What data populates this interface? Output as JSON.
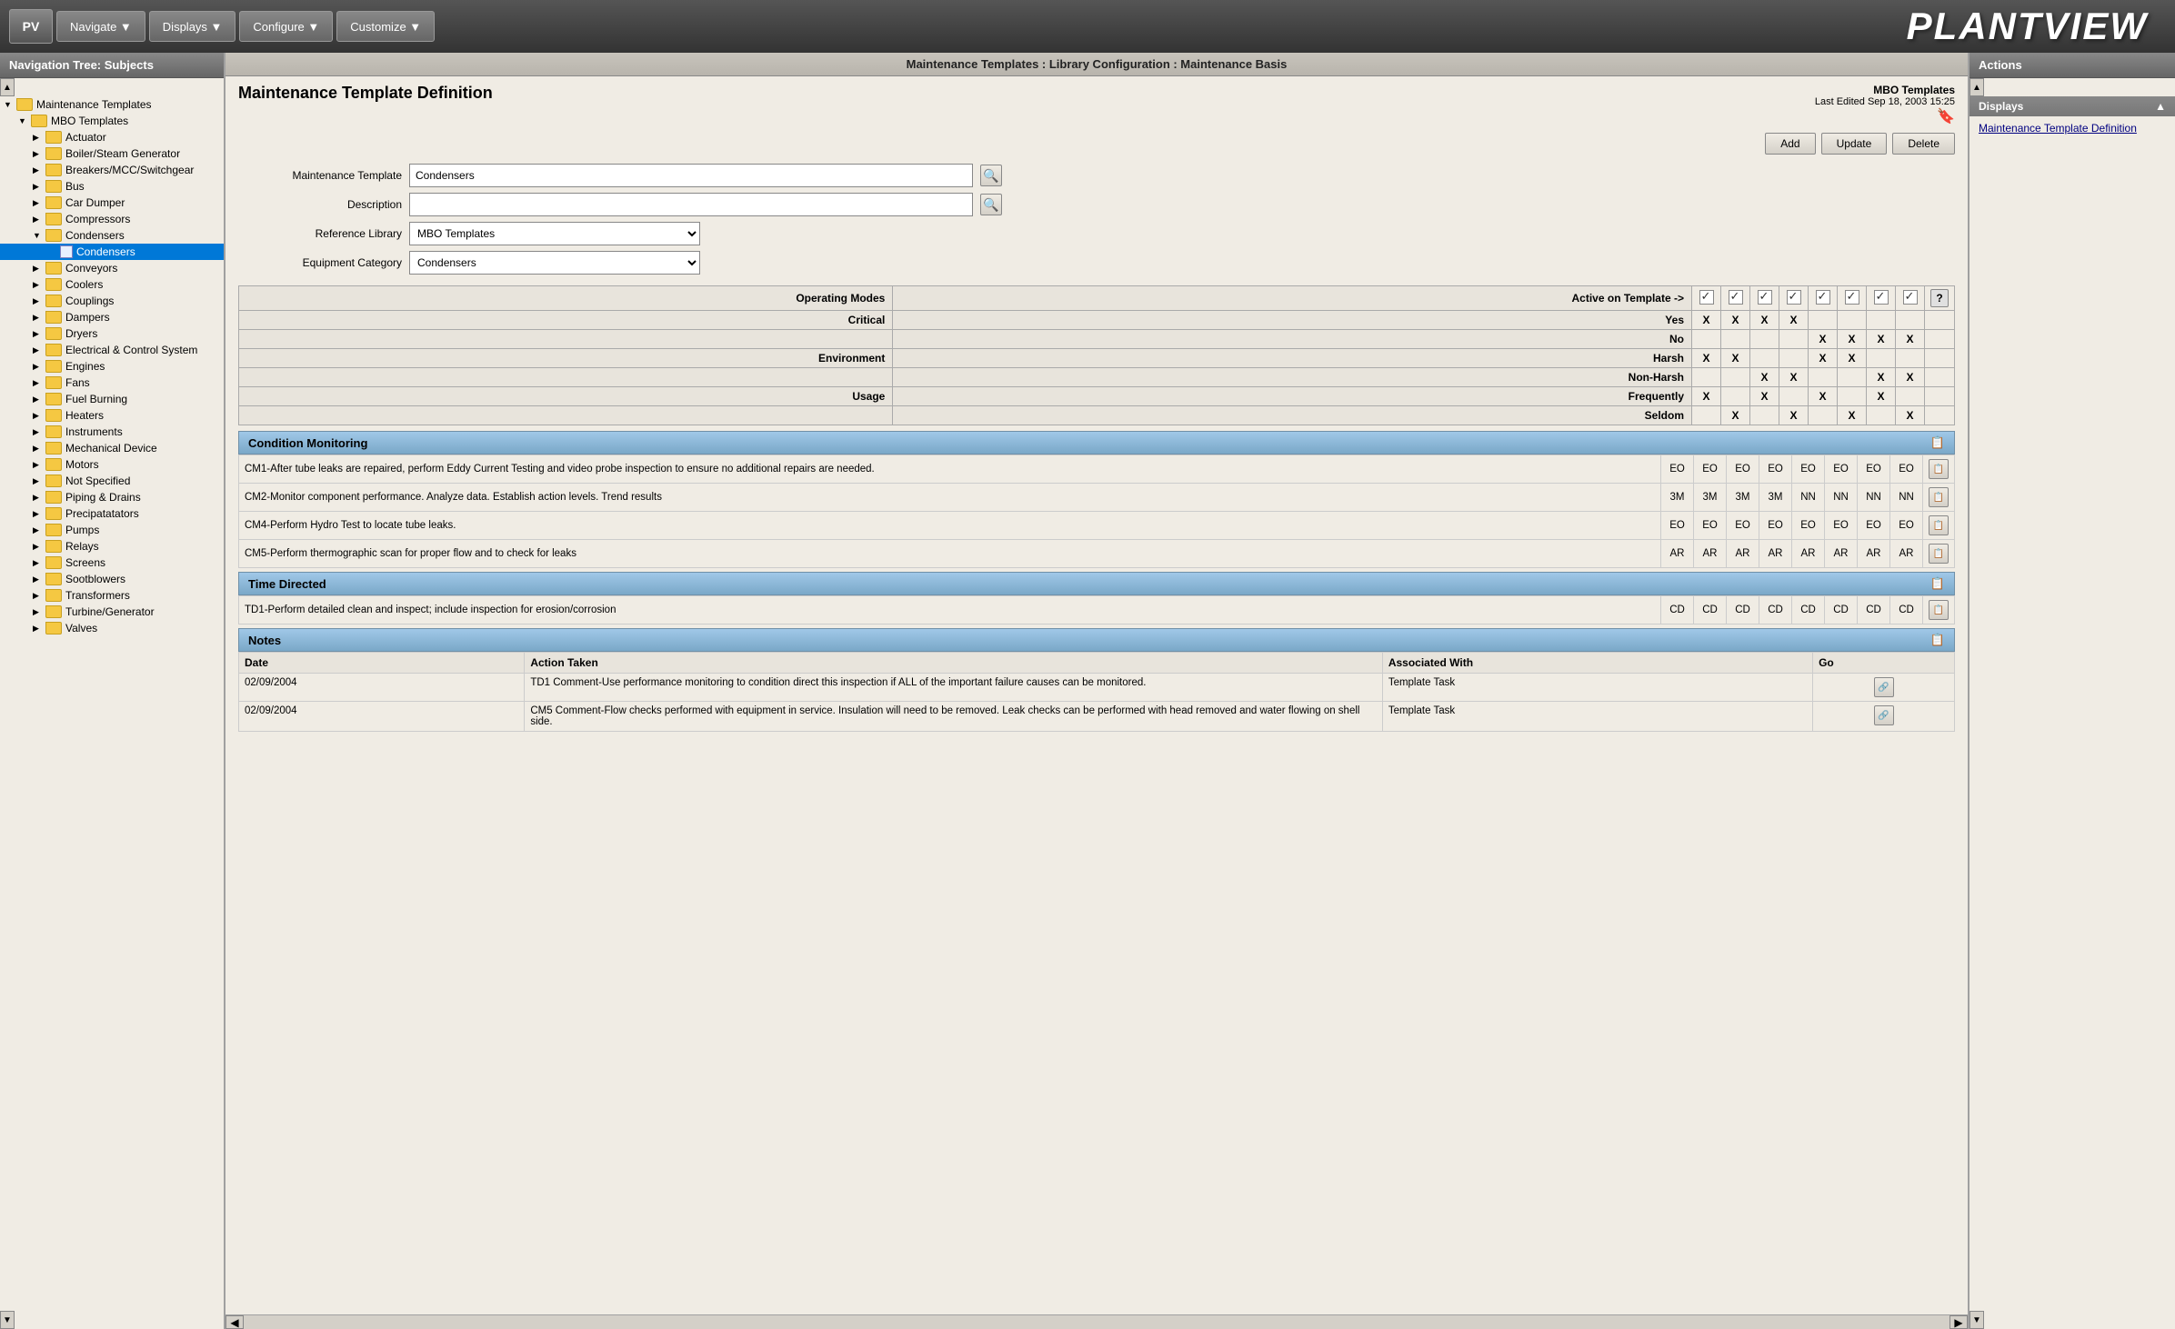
{
  "app": {
    "logo_text": "PV",
    "plantview_text": "PLANTVIEW"
  },
  "toolbar": {
    "navigate_label": "Navigate ▼",
    "displays_label": "Displays ▼",
    "configure_label": "Configure ▼",
    "customize_label": "Customize ▼"
  },
  "breadcrumb": {
    "text": "Maintenance Templates : Library Configuration : Maintenance Basis"
  },
  "content": {
    "title": "Maintenance Template Definition",
    "mbo_badge_line1": "MBO Templates",
    "mbo_badge_line2": "Last Edited Sep 18, 2003 15:25",
    "add_label": "Add",
    "update_label": "Update",
    "delete_label": "Delete"
  },
  "form": {
    "template_label": "Maintenance Template",
    "template_value": "Condensers",
    "description_label": "Description",
    "description_value": "",
    "ref_library_label": "Reference Library",
    "ref_library_value": "MBO Templates",
    "eq_category_label": "Equipment Category",
    "eq_category_value": "Condensers",
    "operating_modes_label": "Operating Modes"
  },
  "operating_modes": {
    "header_label": "Active on Template ->",
    "rows": [
      {
        "group": "Critical",
        "label": "Yes",
        "values": [
          "X",
          "X",
          "X",
          "X",
          "",
          "",
          "",
          ""
        ]
      },
      {
        "group": "",
        "label": "No",
        "values": [
          "",
          "",
          "",
          "",
          "X",
          "X",
          "X",
          "X"
        ]
      },
      {
        "group": "Environment",
        "label": "Harsh",
        "values": [
          "X",
          "X",
          "",
          "",
          "X",
          "X",
          "",
          ""
        ]
      },
      {
        "group": "",
        "label": "Non-Harsh",
        "values": [
          "",
          "",
          "X",
          "X",
          "",
          "",
          "X",
          "X"
        ]
      },
      {
        "group": "Usage",
        "label": "Frequently",
        "values": [
          "X",
          "",
          "X",
          "",
          "X",
          "",
          "X",
          ""
        ]
      },
      {
        "group": "",
        "label": "Seldom",
        "values": [
          "",
          "X",
          "",
          "X",
          "",
          "X",
          "",
          "X"
        ]
      }
    ],
    "checkboxes": [
      true,
      true,
      true,
      true,
      true,
      true,
      true,
      true
    ]
  },
  "condition_monitoring": {
    "title": "Condition Monitoring",
    "rows": [
      {
        "desc": "CM1-After tube leaks are repaired, perform Eddy Current Testing and video probe inspection to ensure no additional repairs are needed.",
        "codes": [
          "EO",
          "EO",
          "EO",
          "EO",
          "EO",
          "EO",
          "EO",
          "EO"
        ]
      },
      {
        "desc": "CM2-Monitor component performance. Analyze data. Establish action levels. Trend results",
        "codes": [
          "3M",
          "3M",
          "3M",
          "3M",
          "NN",
          "NN",
          "NN",
          "NN"
        ]
      },
      {
        "desc": "CM4-Perform Hydro Test to locate tube leaks.",
        "codes": [
          "EO",
          "EO",
          "EO",
          "EO",
          "EO",
          "EO",
          "EO",
          "EO"
        ]
      },
      {
        "desc": "CM5-Perform thermographic scan for proper flow and to check for leaks",
        "codes": [
          "AR",
          "AR",
          "AR",
          "AR",
          "AR",
          "AR",
          "AR",
          "AR"
        ]
      }
    ]
  },
  "time_directed": {
    "title": "Time Directed",
    "rows": [
      {
        "desc": "TD1-Perform detailed clean and inspect; include inspection for erosion/corrosion",
        "codes": [
          "CD",
          "CD",
          "CD",
          "CD",
          "CD",
          "CD",
          "CD",
          "CD"
        ]
      }
    ]
  },
  "notes": {
    "title": "Notes",
    "columns": [
      "Date",
      "Action Taken",
      "Associated With",
      "Go"
    ],
    "rows": [
      {
        "date": "02/09/2004",
        "action": "TD1 Comment-Use performance monitoring to condition direct this inspection if ALL of the important failure causes can be monitored.",
        "assoc": "Template Task",
        "go": ""
      },
      {
        "date": "02/09/2004",
        "action": "CM5 Comment-Flow checks performed with equipment in service. Insulation will need to be removed. Leak checks can be performed with head removed and water flowing on shell side.",
        "assoc": "Template Task",
        "go": ""
      }
    ]
  },
  "sidebar": {
    "header": "Navigation Tree: Subjects",
    "items": [
      {
        "level": 0,
        "label": "Maintenance Templates",
        "expand": "▼",
        "type": "folder-open"
      },
      {
        "level": 1,
        "label": "MBO Templates",
        "expand": "▼",
        "type": "folder-open"
      },
      {
        "level": 2,
        "label": "Actuator",
        "expand": "▶",
        "type": "folder"
      },
      {
        "level": 2,
        "label": "Boiler/Steam Generator",
        "expand": "▶",
        "type": "folder"
      },
      {
        "level": 2,
        "label": "Breakers/MCC/Switchgear",
        "expand": "▶",
        "type": "folder"
      },
      {
        "level": 2,
        "label": "Bus",
        "expand": "▶",
        "type": "folder"
      },
      {
        "level": 2,
        "label": "Car Dumper",
        "expand": "▶",
        "type": "folder"
      },
      {
        "level": 2,
        "label": "Compressors",
        "expand": "▶",
        "type": "folder"
      },
      {
        "level": 2,
        "label": "Condensers",
        "expand": "▼",
        "type": "folder-open"
      },
      {
        "level": 3,
        "label": "Condensers",
        "expand": "",
        "type": "doc",
        "selected": true
      },
      {
        "level": 2,
        "label": "Conveyors",
        "expand": "▶",
        "type": "folder"
      },
      {
        "level": 2,
        "label": "Coolers",
        "expand": "▶",
        "type": "folder"
      },
      {
        "level": 2,
        "label": "Couplings",
        "expand": "▶",
        "type": "folder"
      },
      {
        "level": 2,
        "label": "Dampers",
        "expand": "▶",
        "type": "folder"
      },
      {
        "level": 2,
        "label": "Dryers",
        "expand": "▶",
        "type": "folder"
      },
      {
        "level": 2,
        "label": "Electrical & Control System",
        "expand": "▶",
        "type": "folder"
      },
      {
        "level": 2,
        "label": "Engines",
        "expand": "▶",
        "type": "folder"
      },
      {
        "level": 2,
        "label": "Fans",
        "expand": "▶",
        "type": "folder"
      },
      {
        "level": 2,
        "label": "Fuel Burning",
        "expand": "▶",
        "type": "folder"
      },
      {
        "level": 2,
        "label": "Heaters",
        "expand": "▶",
        "type": "folder"
      },
      {
        "level": 2,
        "label": "Instruments",
        "expand": "▶",
        "type": "folder"
      },
      {
        "level": 2,
        "label": "Mechanical Device",
        "expand": "▶",
        "type": "folder"
      },
      {
        "level": 2,
        "label": "Motors",
        "expand": "▶",
        "type": "folder"
      },
      {
        "level": 2,
        "label": "Not Specified",
        "expand": "▶",
        "type": "folder"
      },
      {
        "level": 2,
        "label": "Piping & Drains",
        "expand": "▶",
        "type": "folder"
      },
      {
        "level": 2,
        "label": "Precipatatators",
        "expand": "▶",
        "type": "folder"
      },
      {
        "level": 2,
        "label": "Pumps",
        "expand": "▶",
        "type": "folder"
      },
      {
        "level": 2,
        "label": "Relays",
        "expand": "▶",
        "type": "folder"
      },
      {
        "level": 2,
        "label": "Screens",
        "expand": "▶",
        "type": "folder"
      },
      {
        "level": 2,
        "label": "Sootblowers",
        "expand": "▶",
        "type": "folder"
      },
      {
        "level": 2,
        "label": "Transformers",
        "expand": "▶",
        "type": "folder"
      },
      {
        "level": 2,
        "label": "Turbine/Generator",
        "expand": "▶",
        "type": "folder"
      },
      {
        "level": 2,
        "label": "Valves",
        "expand": "▶",
        "type": "folder"
      }
    ]
  },
  "actions_panel": {
    "header": "Actions",
    "section": "Displays",
    "items": [
      {
        "label": "Maintenance Template Definition"
      }
    ]
  }
}
